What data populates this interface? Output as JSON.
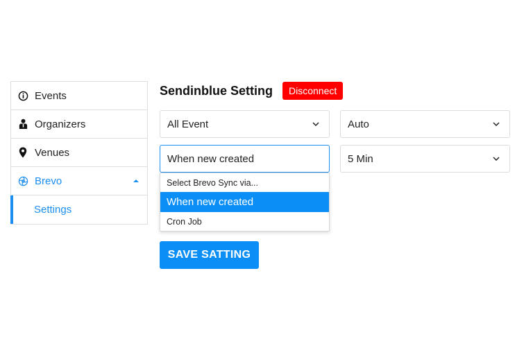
{
  "sidebar": {
    "items": [
      {
        "label": "Events",
        "icon": "info-circle-icon"
      },
      {
        "label": "Organizers",
        "icon": "person-icon"
      },
      {
        "label": "Venues",
        "icon": "map-pin-icon"
      },
      {
        "label": "Brevo",
        "icon": "brevo-swirl-icon"
      },
      {
        "label": "Settings"
      }
    ]
  },
  "header": {
    "title": "Sendinblue Setting",
    "disconnect_label": "Disconnect"
  },
  "form": {
    "event_select": "All Event",
    "mode_select": "Auto",
    "sync_select": "When new created",
    "interval_select": "5 Min"
  },
  "dropdown": {
    "options": [
      "Select Brevo Sync via...",
      "When new created",
      "Cron Job"
    ],
    "selected_index": 1
  },
  "save_label": "SAVE SATTING",
  "colors": {
    "accent": "#0b8ff7",
    "danger": "#ff0000"
  }
}
